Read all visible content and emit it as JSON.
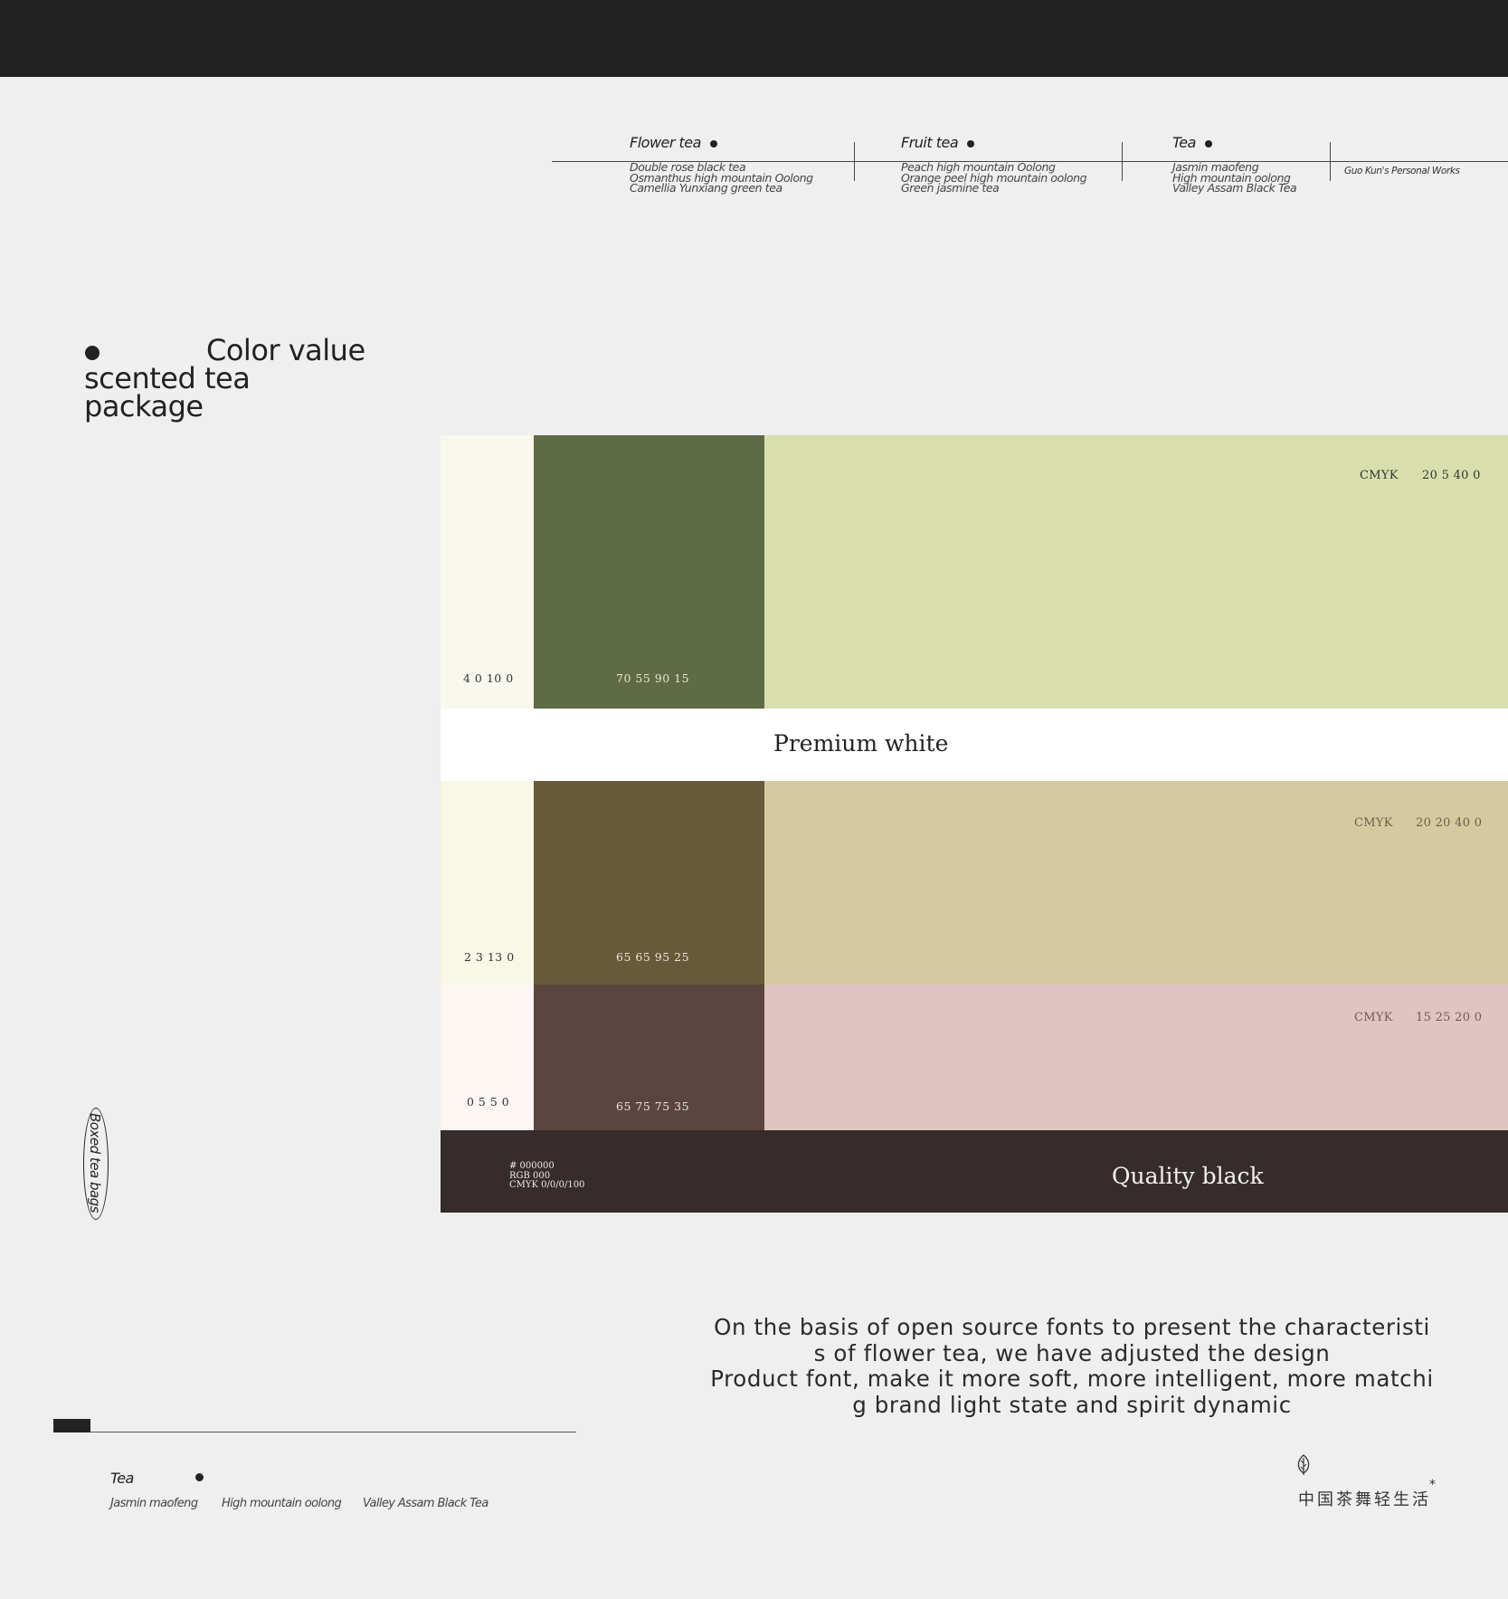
{
  "nav": {
    "columns": [
      {
        "title": "Flower tea",
        "items": [
          "Double rose black tea",
          "Osmanthus high mountain Oolong",
          "Camellia Yunxiang green tea"
        ]
      },
      {
        "title": "Fruit tea",
        "items": [
          "Peach high mountain Oolong",
          "Orange peel high mountain oolong",
          "Green jasmine tea"
        ]
      },
      {
        "title": "Tea",
        "items": [
          "Jasmin maofeng",
          "High mountain oolong",
          "Valley Assam Black Tea"
        ]
      }
    ],
    "credit": "Guo Kun's Personal Works"
  },
  "heading": {
    "line1": "Color value",
    "line2": "scented tea",
    "line3": "package"
  },
  "palette": {
    "row1": {
      "light_value": "4 0 10 0",
      "dark_value": "70 55 90 15",
      "cmyk_label": "CMYK",
      "cmyk_value": "20 5 40 0",
      "colors": {
        "light": "#f8f8ee",
        "dark": "#5f6b44",
        "main": "#d8dfad"
      }
    },
    "white_band": {
      "label": "Premium white",
      "color": "#ffffff"
    },
    "row2": {
      "light_value": "2 3 13 0",
      "dark_value": "65 65 95 25",
      "cmyk_label": "CMYK",
      "cmyk_value": "20 20 40 0",
      "colors": {
        "light": "#f9f7e6",
        "dark": "#675939",
        "main": "#d5c9a0"
      }
    },
    "row3": {
      "light_value": "0 5 5 0",
      "dark_value": "65 75 75 35",
      "cmyk_label": "CMYK",
      "cmyk_value": "15 25 20 0",
      "colors": {
        "light": "#fdf6f2",
        "dark": "#5c4540",
        "main": "#dec4c3"
      }
    },
    "black_band": {
      "hex": "# 000000",
      "rgb": "RGB 000",
      "cmyk": "CMYK 0/0/0/100",
      "label": "Quality black",
      "color": "#352c2b"
    }
  },
  "badge": "Boxed tea bags",
  "footer": {
    "title": "Tea",
    "items": [
      "Jasmin maofeng",
      "High mountain oolong",
      "Valley Assam Black Tea"
    ]
  },
  "paragraph": {
    "lines": [
      "On the basis of open source fonts to present the characteristi",
      "s of flower tea, we have adjusted the design",
      "Product font, make it more soft, more intelligent, more matchi",
      "g brand light state and spirit dynamic"
    ]
  },
  "logo": {
    "text": "中国茶舞轻生活",
    "mark": "*",
    "icon": "leaf-icon"
  }
}
